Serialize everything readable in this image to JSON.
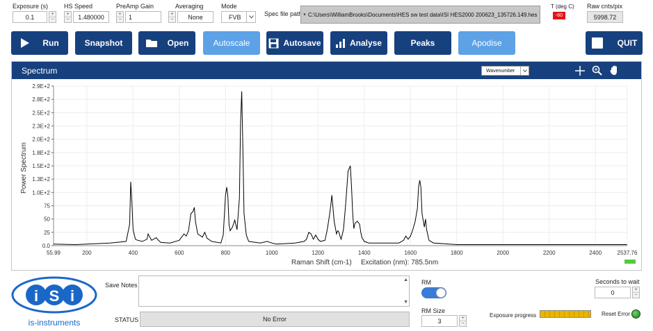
{
  "controls": {
    "exposure": {
      "label": "Exposure (s)",
      "value": "0.1"
    },
    "hs_speed": {
      "label": "HS Speed",
      "value": "1.480000"
    },
    "preamp": {
      "label": "PreAmp Gain",
      "value": "1"
    },
    "averaging": {
      "label": "Averaging",
      "value": "None"
    },
    "mode": {
      "label": "Mode",
      "value": "FVB"
    },
    "spec_file": {
      "label": "Spec file path",
      "value": "C:\\Users\\WilliamBrooks\\Documents\\HES sw test data\\ISI HES2000 200623_135726.149.hes"
    },
    "temp": {
      "label": "T (deg C)",
      "value": "-60",
      "color": "#e0141c"
    },
    "raw": {
      "label": "Raw cnts/pix",
      "value": "5998.72"
    }
  },
  "toolbar": {
    "run": "Run",
    "snapshot": "Snapshot",
    "open": "Open",
    "autoscale": "Autoscale",
    "autosave": "Autosave",
    "analyse": "Analyse",
    "peaks": "Peaks",
    "apodise": "Apodise",
    "quit": "QUIT"
  },
  "spectrum": {
    "title": "Spectrum",
    "unit_select": "Wavenumber"
  },
  "chart_data": {
    "type": "line",
    "title": "",
    "xlabel": "Raman Shift (cm-1)",
    "ylabel": "Power Spectrum",
    "annotation": "Excitation (nm): 785.5nm",
    "xlim": [
      55.99,
      2537.76
    ],
    "ylim": [
      0,
      300
    ],
    "x_ticks": [
      "55.99",
      "200",
      "400",
      "600",
      "800",
      "1000",
      "1200",
      "1400",
      "1600",
      "1800",
      "2000",
      "2200",
      "2400",
      "2537.76"
    ],
    "y_ticks": [
      "0.0",
      "25",
      "50",
      "75",
      "1.0E+2",
      "1.3E+2",
      "1.5E+2",
      "1.8E+2",
      "2.0E+2",
      "2.3E+2",
      "2.5E+2",
      "2.8E+2",
      "2.9E+2"
    ],
    "grid": true,
    "series": [
      {
        "color": "#000000",
        "x": [
          56,
          150,
          300,
          370,
          385,
          390,
          395,
          400,
          410,
          420,
          440,
          460,
          465,
          470,
          480,
          500,
          510,
          520,
          560,
          600,
          620,
          630,
          640,
          650,
          660,
          665,
          670,
          680,
          700,
          710,
          720,
          740,
          780,
          790,
          800,
          805,
          810,
          815,
          820,
          830,
          840,
          850,
          860,
          865,
          870,
          875,
          880,
          890,
          900,
          950,
          980,
          1000,
          1020,
          1100,
          1140,
          1150,
          1160,
          1170,
          1180,
          1190,
          1200,
          1210,
          1230,
          1240,
          1250,
          1255,
          1260,
          1265,
          1270,
          1280,
          1285,
          1290,
          1295,
          1300,
          1310,
          1320,
          1330,
          1340,
          1345,
          1350,
          1355,
          1360,
          1370,
          1380,
          1385,
          1390,
          1400,
          1420,
          1450,
          1500,
          1550,
          1570,
          1580,
          1590,
          1600,
          1610,
          1620,
          1630,
          1635,
          1640,
          1645,
          1650,
          1660,
          1665,
          1670,
          1680,
          1700,
          1800,
          2000,
          2200,
          2400,
          2537
        ],
        "y": [
          3,
          2,
          5,
          8,
          40,
          120,
          80,
          30,
          12,
          10,
          8,
          12,
          22,
          18,
          10,
          15,
          10,
          6,
          5,
          10,
          22,
          18,
          28,
          60,
          65,
          72,
          45,
          22,
          16,
          25,
          14,
          8,
          5,
          20,
          95,
          110,
          92,
          40,
          28,
          35,
          48,
          30,
          90,
          230,
          290,
          180,
          60,
          20,
          8,
          5,
          8,
          5,
          3,
          5,
          8,
          12,
          25,
          22,
          12,
          20,
          12,
          8,
          10,
          30,
          58,
          75,
          95,
          70,
          45,
          22,
          28,
          26,
          18,
          12,
          30,
          80,
          140,
          150,
          110,
          60,
          32,
          42,
          46,
          40,
          25,
          15,
          8,
          5,
          5,
          5,
          5,
          10,
          18,
          12,
          18,
          30,
          45,
          70,
          110,
          123,
          110,
          60,
          35,
          50,
          30,
          10,
          5,
          2,
          2,
          2,
          2,
          2
        ]
      }
    ]
  },
  "bottom": {
    "logo_text": "is-instruments",
    "save_notes_label": "Save Notes",
    "save_notes_value": "",
    "status_label": "STATUS",
    "status_value": "No Error",
    "rm_label": "RM",
    "rm_on": true,
    "rm_size_label": "RM Size",
    "rm_size_value": "3",
    "seconds_label": "Seconds to wait",
    "seconds_value": "0",
    "exposure_progress_label": "Exposure progress",
    "exposure_progress": 1.0,
    "reset_error_label": "Reset Error"
  },
  "colors": {
    "accent_dark": "#17407e",
    "accent_light": "#5da1e6",
    "led_green": "#2a9a2a",
    "progress": "#e8b600"
  }
}
